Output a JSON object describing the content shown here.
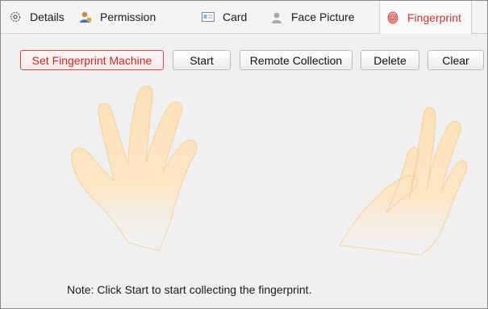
{
  "tabs": [
    {
      "label": "Details",
      "icon": "gear-icon",
      "active": false
    },
    {
      "label": "Permission",
      "icon": "user-permission-icon",
      "active": false
    },
    {
      "label": "Card",
      "icon": "card-icon",
      "active": false
    },
    {
      "label": "Face Picture",
      "icon": "face-picture-icon",
      "active": false
    },
    {
      "label": "Fingerprint",
      "icon": "fingerprint-icon",
      "active": true
    }
  ],
  "toolbar": {
    "set_machine_label": "Set Fingerprint Machine",
    "start_label": "Start",
    "remote_label": "Remote Collection",
    "delete_label": "Delete",
    "clear_label": "Clear"
  },
  "note": "Note: Click Start to start collecting the fingerprint.",
  "colors": {
    "accent": "#d0342c",
    "hand": "#fde0b8",
    "background": "#f0f0f0"
  }
}
